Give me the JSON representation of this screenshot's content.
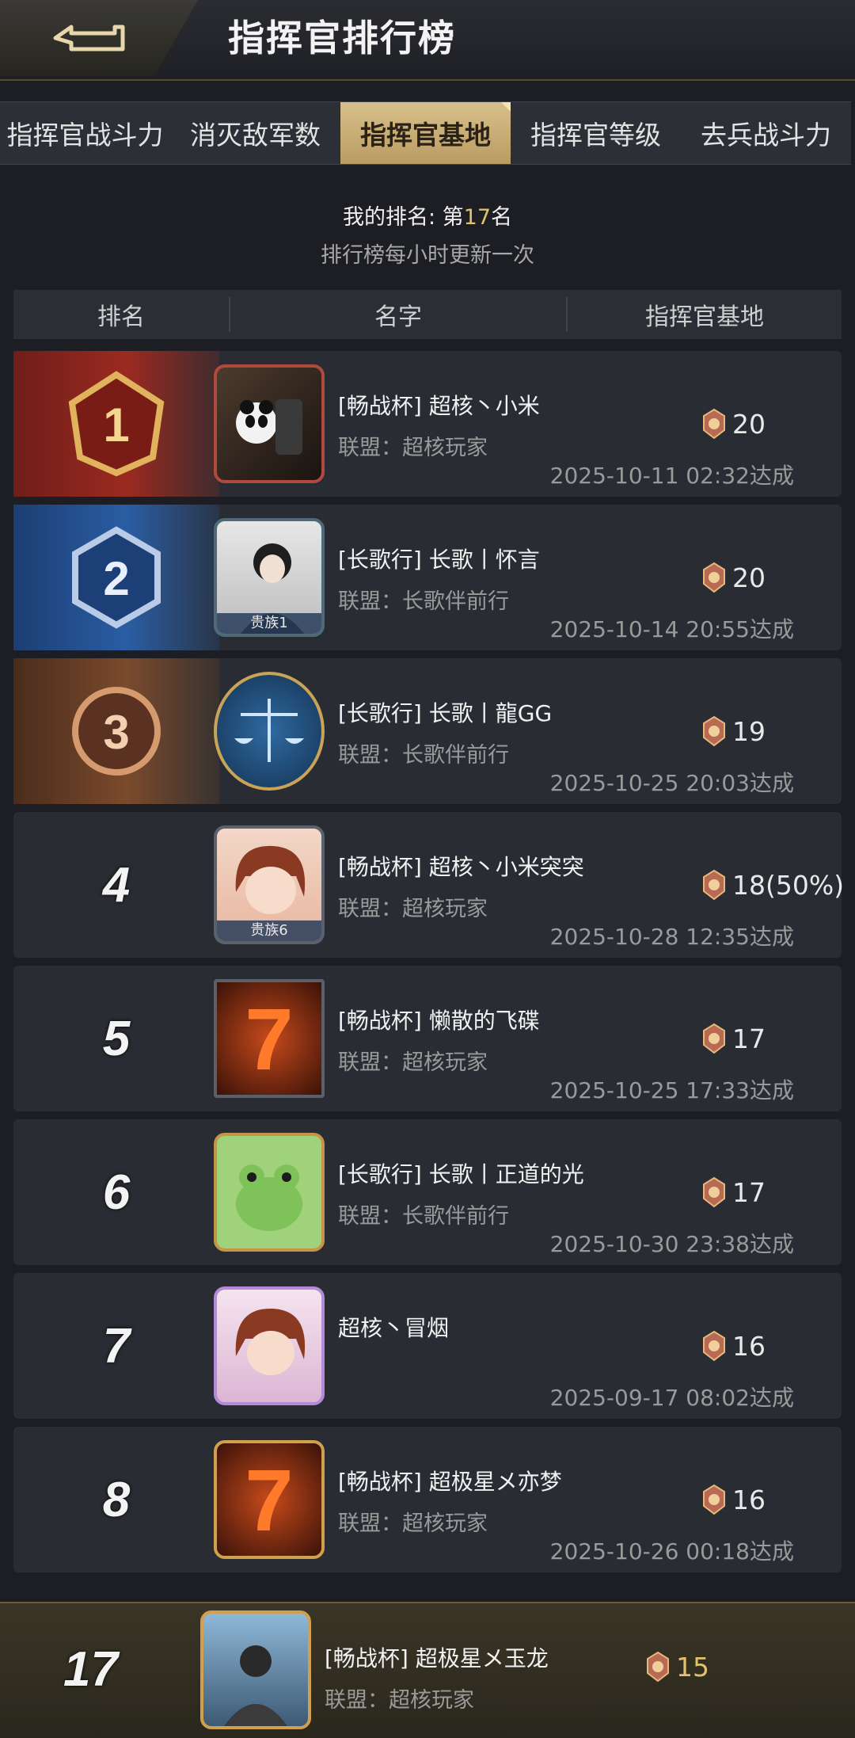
{
  "header": {
    "title": "指挥官排行榜"
  },
  "tabs": [
    {
      "label": "指挥官战斗力",
      "active": false
    },
    {
      "label": "消灭敌军数",
      "active": false
    },
    {
      "label": "指挥官基地",
      "active": true
    },
    {
      "label": "指挥官等级",
      "active": false
    },
    {
      "label": "去兵战斗力",
      "active": false
    }
  ],
  "my_rank": {
    "prefix": "我的排名: 第",
    "number": "17",
    "suffix": "名",
    "note": "排行榜每小时更新一次"
  },
  "columns": {
    "rank": "排名",
    "name": "名字",
    "value": "指挥官基地"
  },
  "rows": [
    {
      "rank": "1",
      "name": "[畅战杯] 超核丶小米",
      "alliance": "联盟：超核玩家",
      "score": "20",
      "time": "2025-10-11 02:32达成",
      "tag": ""
    },
    {
      "rank": "2",
      "name": "[长歌行] 长歌丨怀言",
      "alliance": "联盟：长歌伴前行",
      "score": "20",
      "time": "2025-10-14 20:55达成",
      "tag": "贵族1"
    },
    {
      "rank": "3",
      "name": "[长歌行] 长歌丨龍GG",
      "alliance": "联盟：长歌伴前行",
      "score": "19",
      "time": "2025-10-25 20:03达成",
      "tag": ""
    },
    {
      "rank": "4",
      "name": "[畅战杯] 超核丶小米突突",
      "alliance": "联盟：超核玩家",
      "score": "18(50%)",
      "time": "2025-10-28 12:35达成",
      "tag": "贵族6"
    },
    {
      "rank": "5",
      "name": "[畅战杯] 懒散的飞碟",
      "alliance": "联盟：超核玩家",
      "score": "17",
      "time": "2025-10-25 17:33达成",
      "tag": ""
    },
    {
      "rank": "6",
      "name": "[长歌行] 长歌丨正道的光",
      "alliance": "联盟：长歌伴前行",
      "score": "17",
      "time": "2025-10-30 23:38达成",
      "tag": ""
    },
    {
      "rank": "7",
      "name": "超核丶冒烟",
      "alliance": "",
      "score": "16",
      "time": "2025-09-17 08:02达成",
      "tag": ""
    },
    {
      "rank": "8",
      "name": "[畅战杯] 超极星メ亦梦",
      "alliance": "联盟：超核玩家",
      "score": "16",
      "time": "2025-10-26 00:18达成",
      "tag": ""
    }
  ],
  "self": {
    "rank": "17",
    "name": "[畅战杯] 超极星メ玉龙",
    "alliance": "联盟：超核玩家",
    "score": "15"
  },
  "colors": {
    "gold_accent": "#e2c16d",
    "tab_active": "#c8ad74",
    "row_bg": "#292c32"
  },
  "icons": {
    "back": "back-arrow-icon",
    "medal": "medal-icon"
  }
}
